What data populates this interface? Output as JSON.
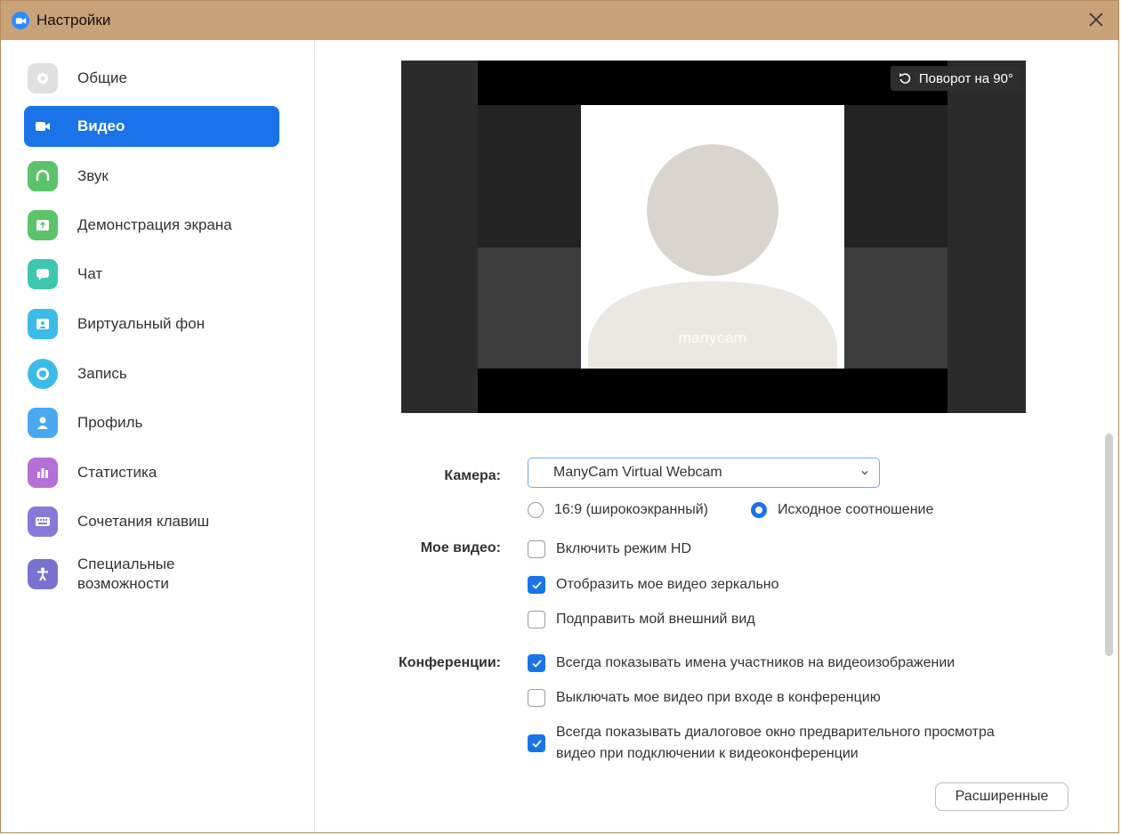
{
  "window": {
    "title": "Настройки"
  },
  "sidebar": {
    "items": [
      {
        "label": "Общие",
        "icon": "gear-icon",
        "color": "#e0e0e0"
      },
      {
        "label": "Видео",
        "icon": "video-camera-icon",
        "color": "#1a73e8",
        "active": true
      },
      {
        "label": "Звук",
        "icon": "headphones-icon",
        "color": "#5cc36b"
      },
      {
        "label": "Демонстрация экрана",
        "icon": "share-screen-icon",
        "color": "#5cc36b"
      },
      {
        "label": "Чат",
        "icon": "chat-bubble-icon",
        "color": "#3ec7b0"
      },
      {
        "label": "Виртуальный фон",
        "icon": "virtual-background-icon",
        "color": "#3bbbe8"
      },
      {
        "label": "Запись",
        "icon": "record-icon",
        "color": "#3bbbe8"
      },
      {
        "label": "Профиль",
        "icon": "profile-icon",
        "color": "#4aa8f0"
      },
      {
        "label": "Статистика",
        "icon": "statistics-icon",
        "color": "#b56fd6"
      },
      {
        "label": "Сочетания клавиш",
        "icon": "keyboard-icon",
        "color": "#8a78d8"
      },
      {
        "label": "Специальные возможности",
        "icon": "accessibility-icon",
        "color": "#7a72cf"
      }
    ]
  },
  "preview": {
    "rotate_label": "Поворот на 90°",
    "watermark": "manycam"
  },
  "camera": {
    "label": "Камера:",
    "selected": "ManyCam Virtual Webcam",
    "ratio_options": [
      {
        "label": "16:9 (широкоэкранный)",
        "selected": false
      },
      {
        "label": "Исходное соотношение",
        "selected": true
      }
    ]
  },
  "my_video": {
    "label": "Мое видео:",
    "options": [
      {
        "label": "Включить режим HD",
        "checked": false
      },
      {
        "label": "Отобразить мое видео зеркально",
        "checked": true
      },
      {
        "label": "Подправить мой внешний вид",
        "checked": false
      }
    ]
  },
  "meetings": {
    "label": "Конференции:",
    "options": [
      {
        "label": "Всегда показывать имена участников на видеоизображении",
        "checked": true
      },
      {
        "label": "Выключать мое видео при входе в конференцию",
        "checked": false
      },
      {
        "label_line1": "Всегда показывать диалоговое окно предварительного просмотра",
        "label_line2": "видео при подключении к видеоконференции",
        "checked": true
      }
    ]
  },
  "advanced_button": "Расширенные",
  "colors": {
    "accent": "#1a73e8",
    "titlebar": "#c9a27a"
  }
}
